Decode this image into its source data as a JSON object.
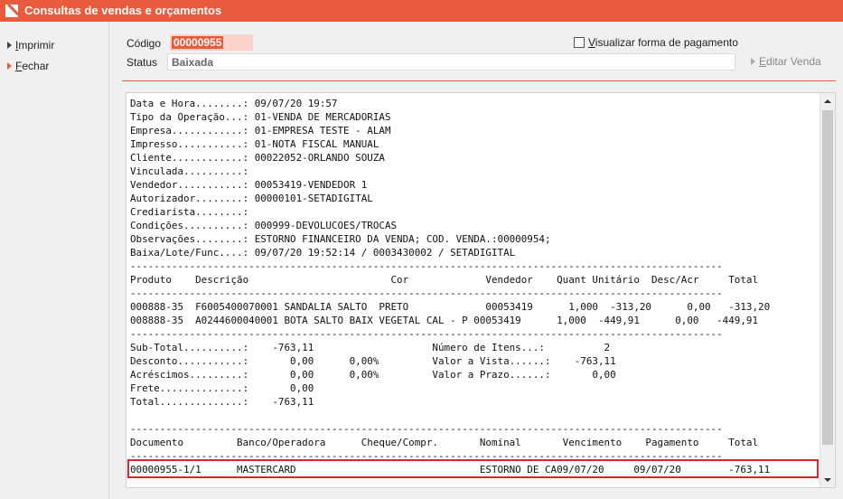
{
  "window": {
    "title": "Consultas de vendas e orçamentos"
  },
  "sidebar": {
    "items": [
      {
        "label": "Imprimir"
      },
      {
        "label": "Fechar"
      }
    ]
  },
  "header": {
    "codigo_label": "Código",
    "codigo_value": "00000955",
    "status_label": "Status",
    "status_value": "Baixada",
    "checkbox_label": "Visualizar forma de pagamento",
    "checkbox_checked": false,
    "editar_label": "Editar Venda"
  },
  "report": {
    "lines": [
      "Data e Hora........: 09/07/20 19:57",
      "Tipo da Operação...: 01-VENDA DE MERCADORIAS",
      "Empresa............: 01-EMPRESA TESTE - ALAM",
      "Impresso...........: 01-NOTA FISCAL MANUAL",
      "Cliente............: 00022052-ORLANDO SOUZA",
      "Vinculada..........:",
      "Vendedor...........: 00053419-VENDEDOR 1",
      "Autorizador........: 00000101-SETADIGITAL",
      "Crediarista........:",
      "Condições..........: 000999-DEVOLUCOES/TROCAS",
      "Observações........: ESTORNO FINANCEIRO DA VENDA; COD. VENDA.:00000954;",
      "Baixa/Lote/Func....: 09/07/20 19:52:14 / 0003430002 / SETADIGITAL",
      "----------------------------------------------------------------------------------------------------",
      "Produto    Descrição                        Cor             Vendedor    Quant Unitário  Desc/Acr     Total",
      "----------------------------------------------------------------------------------------------------",
      "000888-35  F6005400070001 SANDALIA SALTO  PRETO             00053419      1,000  -313,20      0,00   -313,20",
      "008888-35  A0244600040001 BOTA SALTO BAIX VEGETAL CAL - P 00053419      1,000  -449,91      0,00   -449,91",
      "----------------------------------------------------------------------------------------------------",
      "Sub-Total..........:    -763,11                    Número de Itens...:          2",
      "Desconto...........:       0,00      0,00%         Valor a Vista......:    -763,11",
      "Acréscimos.........:       0,00      0,00%         Valor a Prazo......:       0,00",
      "Frete..............:       0,00",
      "Total..............:    -763,11",
      "",
      "----------------------------------------------------------------------------------------------------",
      "Documento         Banco/Operadora      Cheque/Compr.       Nominal       Vencimento    Pagamento     Total",
      "----------------------------------------------------------------------------------------------------",
      "00000955-1/1      MASTERCARD                               ESTORNO DE CA09/07/20     09/07/20        -763,11"
    ]
  },
  "colors": {
    "accent": "#ea5a3c",
    "highlight_border": "#d9282d"
  }
}
